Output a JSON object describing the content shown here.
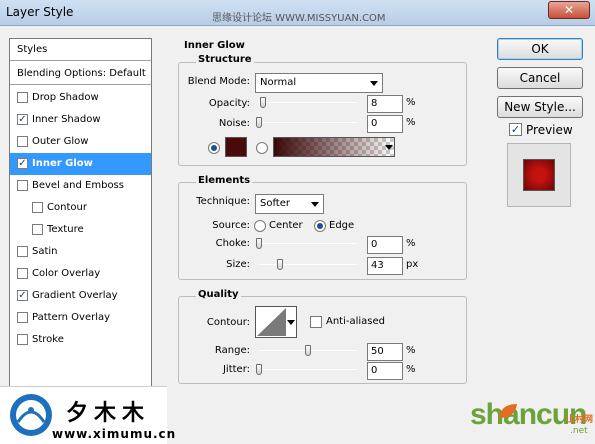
{
  "window": {
    "title": "Layer Style",
    "watermark": "思缘设计论坛 WWW.MISSYUAN.COM",
    "close_glyph": "✕"
  },
  "styles_panel": {
    "header": "Styles",
    "blending": "Blending Options: Default",
    "items": [
      {
        "label": "Drop Shadow",
        "checked": false
      },
      {
        "label": "Inner Shadow",
        "checked": true
      },
      {
        "label": "Outer Glow",
        "checked": false
      },
      {
        "label": "Inner Glow",
        "checked": true,
        "selected": true
      },
      {
        "label": "Bevel and Emboss",
        "checked": false
      },
      {
        "label": "Contour",
        "checked": false,
        "sub": true
      },
      {
        "label": "Texture",
        "checked": false,
        "sub": true
      },
      {
        "label": "Satin",
        "checked": false
      },
      {
        "label": "Color Overlay",
        "checked": false
      },
      {
        "label": "Gradient Overlay",
        "checked": true
      },
      {
        "label": "Pattern Overlay",
        "checked": false
      },
      {
        "label": "Stroke",
        "checked": false
      }
    ]
  },
  "inner_glow": {
    "title": "Inner Glow",
    "structure": {
      "title": "Structure",
      "blend_mode_label": "Blend Mode:",
      "blend_mode": "Normal",
      "opacity_label": "Opacity:",
      "opacity": "8",
      "opacity_level": 8,
      "noise_label": "Noise:",
      "noise": "0",
      "noise_level": 0,
      "percent": "%",
      "glow_color": "#4a0a0a"
    },
    "elements": {
      "title": "Elements",
      "technique_label": "Technique:",
      "technique": "Softer",
      "source_label": "Source:",
      "source_center": "Center",
      "source_edge": "Edge",
      "choke_label": "Choke:",
      "choke": "0",
      "choke_level": 0,
      "size_label": "Size:",
      "size": "43",
      "size_level": 17,
      "percent": "%",
      "px": "px"
    },
    "quality": {
      "title": "Quality",
      "contour_label": "Contour:",
      "anti_aliased": "Anti-aliased",
      "range_label": "Range:",
      "range": "50",
      "range_level": 50,
      "jitter_label": "Jitter:",
      "jitter": "0",
      "jitter_level": 0,
      "percent": "%"
    }
  },
  "buttons": {
    "ok": "OK",
    "cancel": "Cancel",
    "new_style": "New Style...",
    "preview": "Preview"
  },
  "preview_color": "#c4120f",
  "logo": {
    "text": "夕木木",
    "url": "www.ximumu.cn"
  },
  "brand": {
    "main": "shancun",
    "cn": "山村网",
    "sub": ".net"
  },
  "icons": {
    "contour": "contour-linear-icon",
    "logo": "ximumu-logo-icon",
    "leaf": "leaf-icon"
  }
}
